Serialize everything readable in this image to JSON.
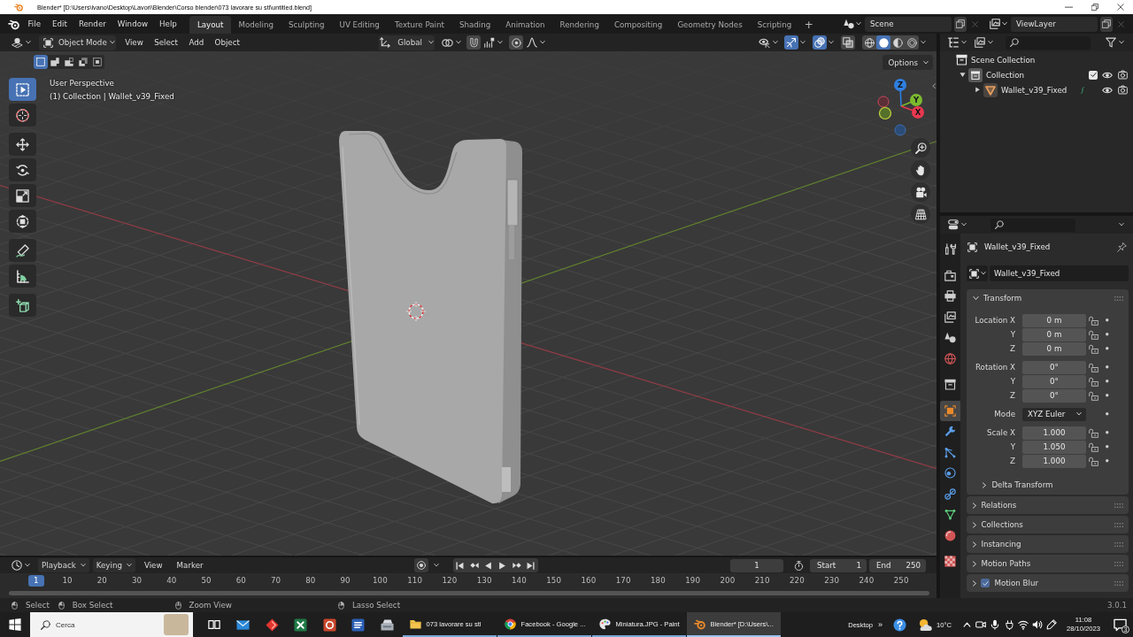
{
  "window": {
    "title": "Blender* [D:\\Users\\ivano\\Desktop\\Lavori\\Blender\\Corso blender\\073 lavorare su stl\\untitled.blend]"
  },
  "menu": [
    "File",
    "Edit",
    "Render",
    "Window",
    "Help"
  ],
  "workspaces": [
    {
      "label": "Layout",
      "selected": true
    },
    {
      "label": "Modeling",
      "selected": false
    },
    {
      "label": "Sculpting",
      "selected": false
    },
    {
      "label": "UV Editing",
      "selected": false
    },
    {
      "label": "Texture Paint",
      "selected": false
    },
    {
      "label": "Shading",
      "selected": false
    },
    {
      "label": "Animation",
      "selected": false
    },
    {
      "label": "Rendering",
      "selected": false
    },
    {
      "label": "Compositing",
      "selected": false
    },
    {
      "label": "Geometry Nodes",
      "selected": false
    },
    {
      "label": "Scripting",
      "selected": false
    }
  ],
  "add_workspace": "+",
  "scene": "Scene",
  "view_layer": "ViewLayer",
  "viewport": {
    "mode": "Object Mode",
    "menus": [
      "View",
      "Select",
      "Add",
      "Object"
    ],
    "orientation": "Global",
    "snap": {
      "on": false
    },
    "proportional_editing": {
      "on": false
    },
    "toggles": [
      {
        "kind": "gizmos",
        "on": true
      },
      {
        "kind": "overlays",
        "on": true
      },
      {
        "kind": "xray",
        "on": false
      }
    ],
    "shading": [
      {
        "kind": "wireframe",
        "selected": false
      },
      {
        "kind": "solid",
        "selected": true
      },
      {
        "kind": "material",
        "selected": false
      },
      {
        "kind": "rendered",
        "selected": false
      }
    ],
    "selection_modes": [
      {
        "kind": "set",
        "selected": true
      },
      {
        "kind": "extend",
        "selected": false
      },
      {
        "kind": "subtract",
        "selected": false
      },
      {
        "kind": "invert",
        "selected": false
      },
      {
        "kind": "intersect",
        "selected": false
      }
    ],
    "options": "Options",
    "info": [
      "User Perspective",
      "(1) Collection | Wallet_v39_Fixed"
    ],
    "tool_groups": [
      {
        "tools": [
          {
            "kind": "select_box",
            "selected": true
          },
          {
            "kind": "cursor",
            "selected": false
          }
        ]
      },
      {
        "tools": [
          {
            "kind": "move",
            "selected": false
          },
          {
            "kind": "rotate",
            "selected": false
          },
          {
            "kind": "scale",
            "selected": false
          },
          {
            "kind": "transform",
            "selected": false
          }
        ]
      },
      {
        "tools": [
          {
            "kind": "annotate",
            "selected": false
          },
          {
            "kind": "measure",
            "selected": false
          }
        ]
      },
      {
        "tools": [
          {
            "kind": "add_cube",
            "selected": false
          }
        ]
      }
    ],
    "axes": [
      {
        "kind": "z",
        "label": "Z"
      },
      {
        "kind": "y",
        "label": "Y"
      },
      {
        "kind": "x",
        "label": "X"
      }
    ]
  },
  "outliner": {
    "items": [
      {
        "kind": "scene_collection",
        "label": "Scene Collection",
        "children": [
          {
            "kind": "collection",
            "label": "Collection",
            "expanded": true,
            "checked": true,
            "children": [
              {
                "kind": "mesh_object",
                "label": "Wallet_v39_Fixed",
                "expanded": false
              }
            ]
          }
        ]
      }
    ]
  },
  "properties": {
    "tab_groups": [
      {
        "tabs": [
          {
            "kind": "tool",
            "selected": false
          }
        ]
      },
      {
        "tabs": [
          {
            "kind": "render",
            "selected": false
          },
          {
            "kind": "output",
            "selected": false
          },
          {
            "kind": "view_layer",
            "selected": false
          },
          {
            "kind": "scene",
            "selected": false
          },
          {
            "kind": "world",
            "selected": false
          }
        ]
      },
      {
        "tabs": [
          {
            "kind": "collection",
            "selected": false
          }
        ]
      },
      {
        "tabs": [
          {
            "kind": "object",
            "selected": true
          },
          {
            "kind": "modifiers",
            "selected": false
          },
          {
            "kind": "particles",
            "selected": false
          },
          {
            "kind": "physics",
            "selected": false
          },
          {
            "kind": "constraints",
            "selected": false
          },
          {
            "kind": "data",
            "selected": false
          },
          {
            "kind": "material",
            "selected": false
          }
        ]
      },
      {
        "tabs": [
          {
            "kind": "texture",
            "selected": false
          }
        ]
      }
    ],
    "object_name": "Wallet_v39_Fixed",
    "datablock": "Wallet_v39_Fixed",
    "transform": {
      "title": "Transform",
      "expanded": true,
      "groups": [
        {
          "rows": [
            {
              "kind": "field",
              "label": "Location X",
              "value": "0 m"
            },
            {
              "kind": "field",
              "label": "Y",
              "value": "0 m"
            },
            {
              "kind": "field",
              "label": "Z",
              "value": "0 m"
            }
          ]
        },
        {
          "rows": [
            {
              "kind": "field",
              "label": "Rotation X",
              "value": "0°"
            },
            {
              "kind": "field",
              "label": "Y",
              "value": "0°"
            },
            {
              "kind": "field",
              "label": "Z",
              "value": "0°"
            }
          ]
        },
        {
          "rows": [
            {
              "kind": "dropdown",
              "label": "Mode",
              "value": "XYZ Euler"
            }
          ]
        },
        {
          "rows": [
            {
              "kind": "field",
              "label": "Scale X",
              "value": "1.000"
            },
            {
              "kind": "field",
              "label": "Y",
              "value": "1.050"
            },
            {
              "kind": "field",
              "label": "Z",
              "value": "1.000"
            }
          ]
        }
      ],
      "subpanels": [
        {
          "title": "Delta Transform",
          "expanded": false
        }
      ]
    },
    "panels": [
      {
        "kind": "plain",
        "title": "Relations",
        "expanded": false
      },
      {
        "kind": "plain",
        "title": "Collections",
        "expanded": false
      },
      {
        "kind": "plain",
        "title": "Instancing",
        "expanded": false
      },
      {
        "kind": "plain",
        "title": "Motion Paths",
        "expanded": false
      },
      {
        "kind": "toggle",
        "title": "Motion Blur",
        "expanded": false,
        "checked": true
      }
    ]
  },
  "timeline": {
    "menus": [
      {
        "kind": "popover",
        "label": "Playback"
      },
      {
        "kind": "popover",
        "label": "Keying"
      },
      {
        "kind": "menu",
        "label": "View"
      },
      {
        "kind": "menu",
        "label": "Marker"
      }
    ],
    "auto_keying": {
      "on": false
    },
    "current_frame": "1",
    "start_label": "Start",
    "start": "1",
    "end_label": "End",
    "end": "250",
    "ruler": [
      {
        "label": "1",
        "selected": true
      },
      {
        "label": "10",
        "selected": false
      },
      {
        "label": "20",
        "selected": false
      },
      {
        "label": "30",
        "selected": false
      },
      {
        "label": "40",
        "selected": false
      },
      {
        "label": "50",
        "selected": false
      },
      {
        "label": "60",
        "selected": false
      },
      {
        "label": "70",
        "selected": false
      },
      {
        "label": "80",
        "selected": false
      },
      {
        "label": "90",
        "selected": false
      },
      {
        "label": "100",
        "selected": false
      },
      {
        "label": "110",
        "selected": false
      },
      {
        "label": "120",
        "selected": false
      },
      {
        "label": "130",
        "selected": false
      },
      {
        "label": "140",
        "selected": false
      },
      {
        "label": "150",
        "selected": false
      },
      {
        "label": "160",
        "selected": false
      },
      {
        "label": "170",
        "selected": false
      },
      {
        "label": "180",
        "selected": false
      },
      {
        "label": "190",
        "selected": false
      },
      {
        "label": "200",
        "selected": false
      },
      {
        "label": "210",
        "selected": false
      },
      {
        "label": "220",
        "selected": false
      },
      {
        "label": "230",
        "selected": false
      },
      {
        "label": "240",
        "selected": false
      },
      {
        "label": "250",
        "selected": false
      }
    ]
  },
  "status_bar": {
    "hints": [
      {
        "kind": "left_click",
        "label": "Select"
      },
      {
        "kind": "left_drag",
        "label": "Box Select"
      },
      {
        "kind": "middle",
        "label": "Zoom View"
      },
      {
        "kind": "right_drag",
        "label": "Lasso Select"
      }
    ],
    "version": "3.0.1"
  },
  "taskbar": {
    "search_placeholder": "Cerca",
    "windows": [
      {
        "kind": "folder",
        "label": "073 lavorare su stl",
        "selected": false
      },
      {
        "kind": "browser",
        "label": "Facebook - Google ...",
        "selected": false
      },
      {
        "kind": "paint",
        "label": "Miniatura.JPG - Paint",
        "selected": false
      },
      {
        "kind": "blender",
        "label": "Blender* [D:\\Users\\...",
        "selected": true
      }
    ],
    "desktop": "Desktop",
    "overflow": "»",
    "temperature": "10°C",
    "time": "11:08",
    "date": "28/10/2023",
    "notifications": "3"
  }
}
